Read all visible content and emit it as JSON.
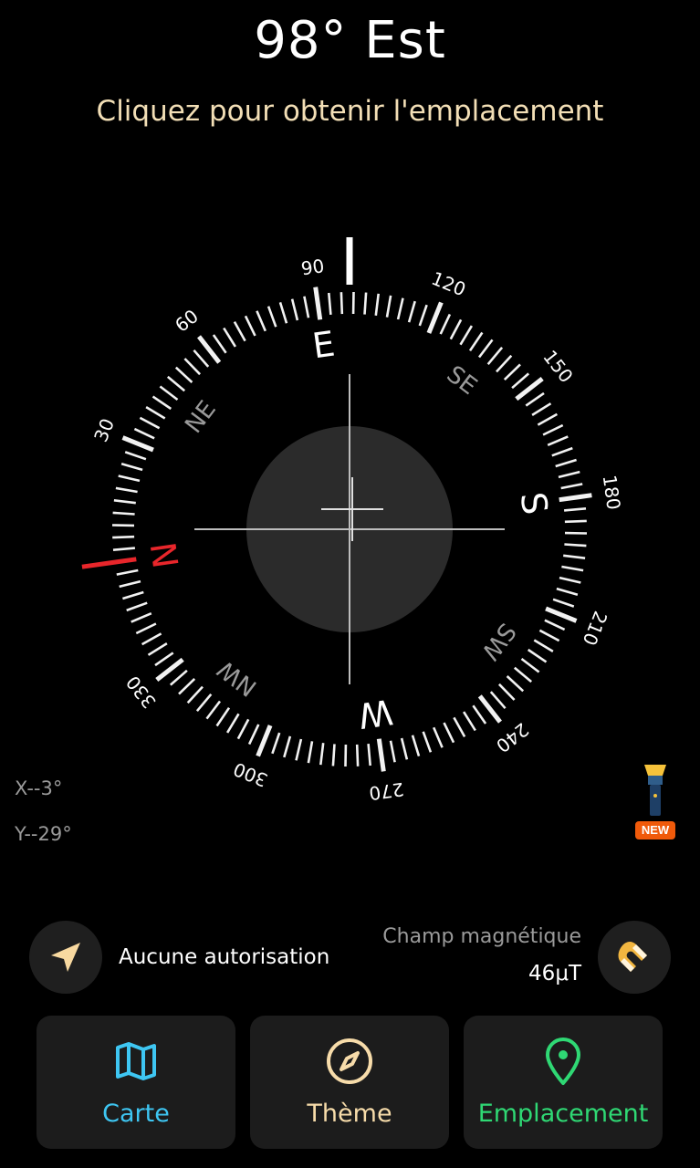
{
  "header": {
    "heading": "98° Est",
    "location_prompt": "Cliquez pour obtenir l'emplacement"
  },
  "compass": {
    "heading_deg": 98,
    "degree_labels": [
      "30",
      "60",
      "90",
      "120",
      "150",
      "180",
      "210",
      "240",
      "270",
      "300",
      "330"
    ],
    "cardinals": {
      "N": "N",
      "E": "E",
      "S": "S",
      "W": "W"
    },
    "intercardinals": {
      "NE": "NE",
      "SE": "SE",
      "SW": "SW",
      "NW": "NW"
    },
    "north_color": "#e8262b"
  },
  "tilt": {
    "x": "X--3°",
    "y": "Y--29°"
  },
  "flashlight": {
    "badge": "NEW",
    "icon": "flashlight-icon"
  },
  "status": {
    "permission_icon": "location-arrow-icon",
    "permission_text": "Aucune autorisation",
    "magnetic_label": "Champ magnétique",
    "magnetic_value": "46μT",
    "magnet_icon": "magnet-icon"
  },
  "nav": [
    {
      "label": "Carte",
      "icon": "map-icon",
      "color": "#3ec6f2"
    },
    {
      "label": "Thème",
      "icon": "compass-icon",
      "color": "#f7dcaa"
    },
    {
      "label": "Emplacement",
      "icon": "location-pin-icon",
      "color": "#2fd874"
    }
  ]
}
